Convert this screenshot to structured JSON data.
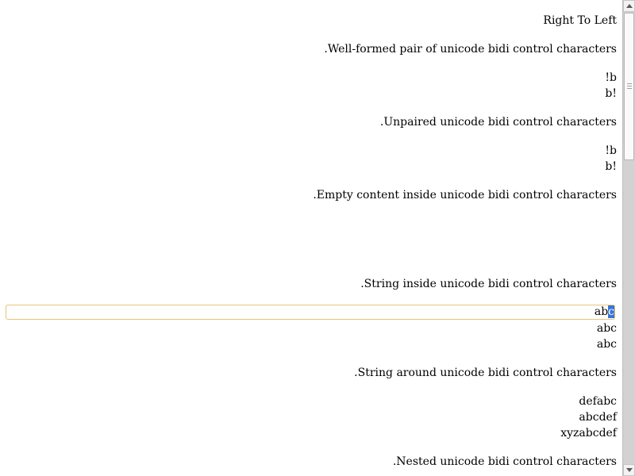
{
  "heading": "Right To Left",
  "sections": {
    "well_formed": {
      "title": ".Well-formed pair of unicode bidi control characters",
      "line1": "!b",
      "line2": "b!"
    },
    "unpaired": {
      "title": ".Unpaired unicode bidi control characters",
      "line1": "!b",
      "line2": "b!"
    },
    "empty": {
      "title": ".Empty content inside unicode bidi control characters"
    },
    "string_inside": {
      "title": ".String inside unicode bidi control characters",
      "editable_text_before_caret": "ab",
      "editable_text_selected": "c",
      "line2": "abc",
      "line3": "abc"
    },
    "string_around": {
      "title": ".String around unicode bidi control characters",
      "line1": "defabc",
      "line2": "abcdef",
      "line3": "xyzabcdef"
    },
    "nested": {
      "title": ".Nested unicode bidi control characters"
    }
  },
  "colors": {
    "focus_border": "#e6c47a",
    "selection": "#3875d7"
  }
}
